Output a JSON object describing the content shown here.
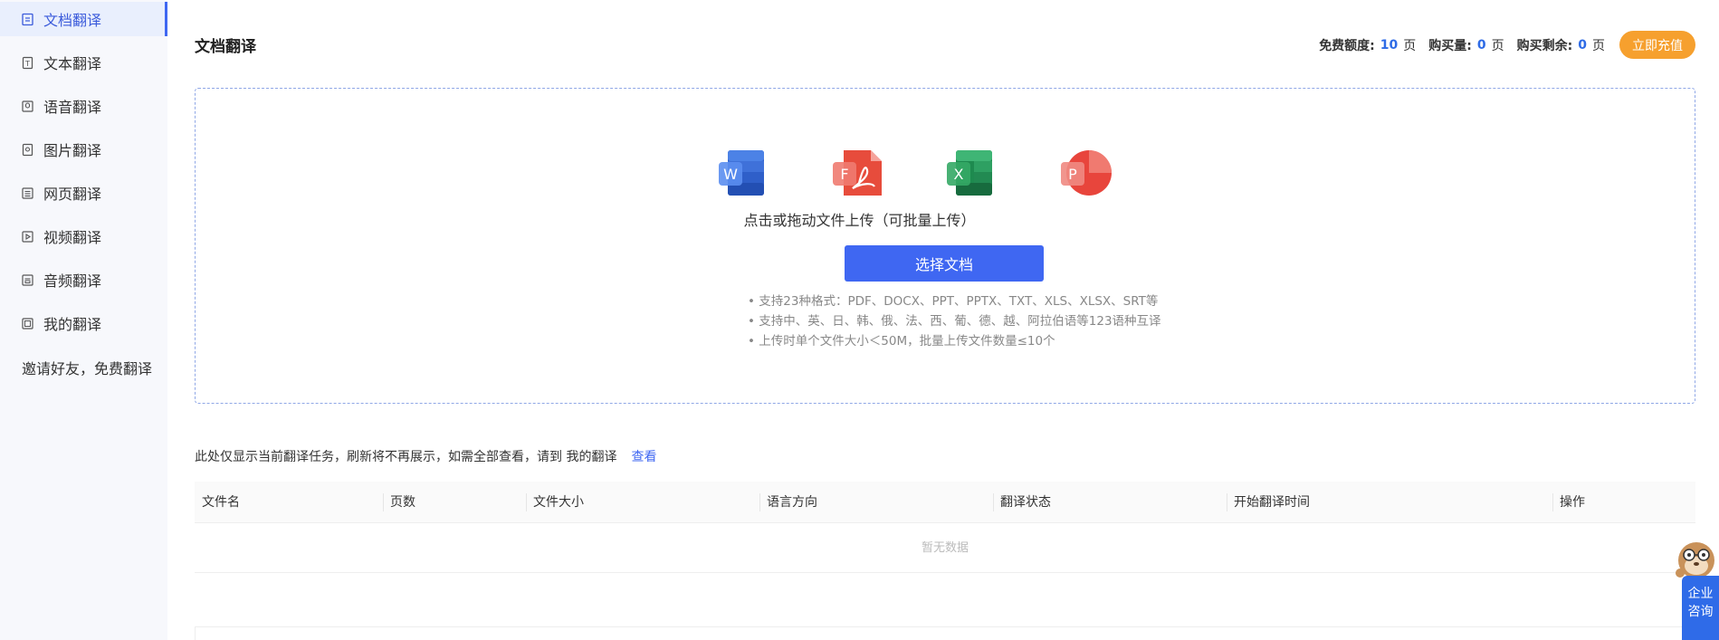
{
  "sidebar": {
    "items": [
      {
        "label": "文档翻译",
        "icon": "document-translate-icon",
        "active": true
      },
      {
        "label": "文本翻译",
        "icon": "text-translate-icon",
        "active": false
      },
      {
        "label": "语音翻译",
        "icon": "voice-translate-icon",
        "active": false
      },
      {
        "label": "图片翻译",
        "icon": "image-translate-icon",
        "active": false
      },
      {
        "label": "网页翻译",
        "icon": "webpage-translate-icon",
        "active": false
      },
      {
        "label": "视频翻译",
        "icon": "video-translate-icon",
        "active": false
      },
      {
        "label": "音频翻译",
        "icon": "audio-translate-icon",
        "active": false
      },
      {
        "label": "我的翻译",
        "icon": "my-translations-icon",
        "active": false
      }
    ],
    "invite": "邀请好友，免费翻译"
  },
  "header": {
    "title": "文档翻译",
    "quota": {
      "free_label": "免费额度:",
      "free_value": "10",
      "purchased_label": "购买量:",
      "purchased_value": "0",
      "remaining_label": "购买剩余:",
      "remaining_value": "0",
      "unit": "页"
    },
    "recharge_label": "立即充值"
  },
  "upload": {
    "file_icons": [
      {
        "name": "word-file-icon",
        "letter": "W"
      },
      {
        "name": "pdf-file-icon",
        "letter": "F"
      },
      {
        "name": "excel-file-icon",
        "letter": "X"
      },
      {
        "name": "powerpoint-file-icon",
        "letter": "P"
      }
    ],
    "hint": "点击或拖动文件上传（可批量上传）",
    "button_label": "选择文档",
    "notes": [
      "支持23种格式：PDF、DOCX、PPT、PPTX、TXT、XLS、XLSX、SRT等",
      "支持中、英、日、韩、俄、法、西、葡、德、越、阿拉伯语等123语种互译",
      "上传时单个文件大小＜50M，批量上传文件数量≤10个"
    ]
  },
  "tasks": {
    "info": "此处仅显示当前翻译任务，刷新将不再展示，如需全部查看，请到 我的翻译",
    "view_link": "查看",
    "columns": [
      "文件名",
      "页数",
      "文件大小",
      "语言方向",
      "翻译状态",
      "开始翻译时间",
      "操作"
    ],
    "empty_text": "暂无数据"
  },
  "consult": {
    "label_line1": "企业",
    "label_line2": "咨询"
  },
  "colors": {
    "accent": "#3f67f2",
    "recharge": "#f6a02e",
    "sidebar_bg": "#f7f8fc"
  }
}
